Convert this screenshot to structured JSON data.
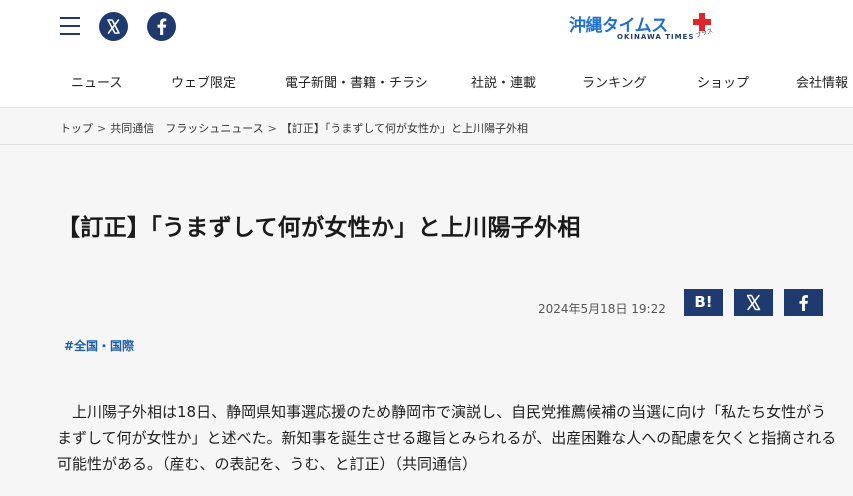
{
  "header": {
    "logo": {
      "main": "沖縄タイムス",
      "plus_kana": "プラス",
      "sub": "OKINAWA TIMES"
    },
    "icons": [
      "hamburger-menu-icon",
      "x-icon",
      "facebook-icon"
    ],
    "colors": {
      "navy": "#1f3a6e",
      "logo_blue": "#1f6fd1",
      "logo_red": "#e0262d"
    }
  },
  "nav": {
    "items": [
      {
        "label": "ニュース"
      },
      {
        "label": "ウェブ限定"
      },
      {
        "label": "電子新聞・書籍・チラシ"
      },
      {
        "label": "社説・連載"
      },
      {
        "label": "ランキング"
      },
      {
        "label": "ショップ"
      },
      {
        "label": "会社情報"
      }
    ]
  },
  "breadcrumb": {
    "items": [
      {
        "label": "トップ"
      },
      {
        "label": "共同通信　フラッシュニュース"
      },
      {
        "label": "【訂正】「うまずして何が女性か」と上川陽子外相"
      }
    ],
    "separator": ">"
  },
  "article": {
    "title": "【訂正】「うまずして何が女性か」と上川陽子外相",
    "date": "2024年5月18日 19:22",
    "share": {
      "hatena_label": "B!"
    },
    "tag": "#全国・国際",
    "body": "　上川陽子外相は18日、静岡県知事選応援のため静岡市で演説し、自民党推薦候補の当選に向け「私たち女性がうまずして何が女性か」と述べた。新知事を誕生させる趣旨とみられるが、出産困難な人への配慮を欠くと指摘される可能性がある。（産む、の表記を、うむ、と訂正）（共同通信）"
  }
}
